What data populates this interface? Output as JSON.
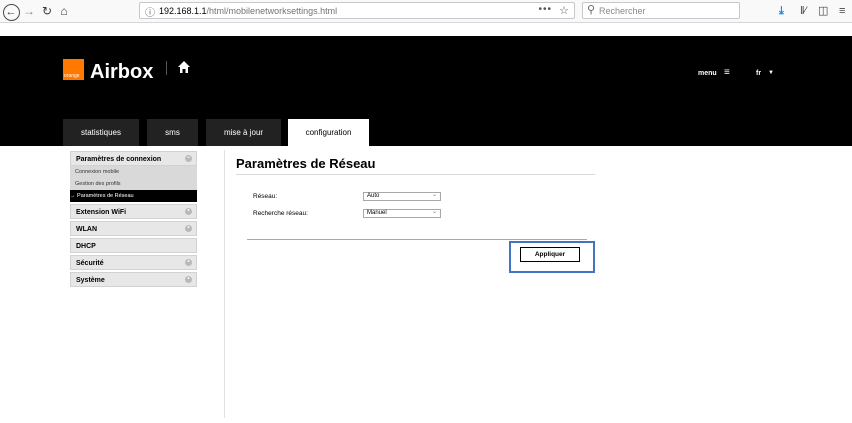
{
  "browser": {
    "url_host": "192.168.1.1",
    "url_path": "/html/mobilenetworksettings.html",
    "search_placeholder": "Rechercher",
    "url_more": "•••"
  },
  "header": {
    "logo_text": "orange",
    "brand": "Airbox",
    "menu_label": "menu",
    "lang": "fr",
    "tabs": [
      {
        "label": "statistiques",
        "active": false
      },
      {
        "label": "sms",
        "active": false
      },
      {
        "label": "mise à jour",
        "active": false
      },
      {
        "label": "configuration",
        "active": true
      }
    ]
  },
  "sidebar": {
    "sections": [
      {
        "label": "Paramètres de connexion",
        "expanded": true,
        "items": [
          "Connexion mobile",
          "Gestion des profils",
          "→ Paramètres de Réseau"
        ]
      },
      {
        "label": "Extension WiFi"
      },
      {
        "label": "WLAN"
      },
      {
        "label": "DHCP"
      },
      {
        "label": "Sécurité"
      },
      {
        "label": "Système"
      }
    ]
  },
  "main": {
    "title": "Paramètres de Réseau",
    "fields": [
      {
        "label": "Réseau:",
        "value": "Auto"
      },
      {
        "label": "Recherche réseau:",
        "value": "Manuel"
      }
    ],
    "apply_label": "Appliquer"
  },
  "colors": {
    "brand_orange": "#ff7900",
    "highlight_blue": "#4472c4",
    "header_bg": "#000000"
  }
}
